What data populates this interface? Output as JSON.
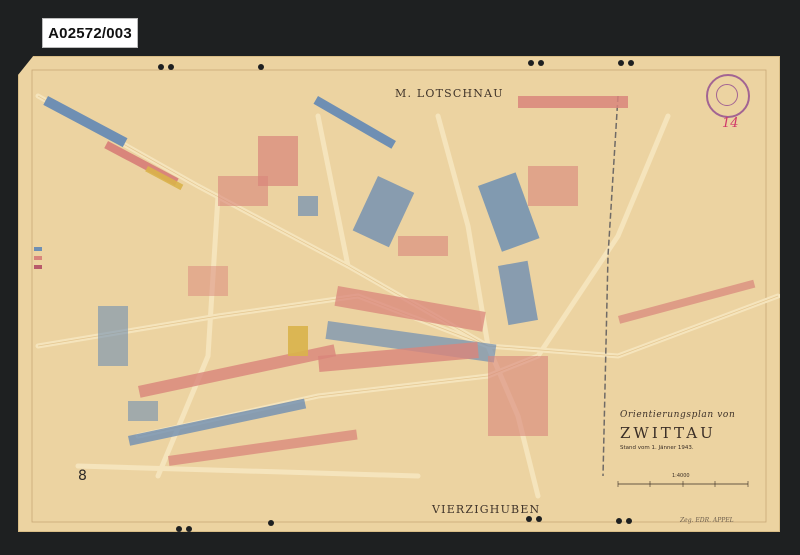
{
  "catalog_id": "A02572/003",
  "map": {
    "north_label": "M. LOTSCHNAU",
    "south_label": "VIERZIGHUBEN",
    "sheet_number": "8",
    "annotation": "14",
    "title_line1": "Orientierungsplan von",
    "title_line2": "ZWITTAU",
    "title_line3": "Stand vom 1. Jänner 1943.",
    "scale_label": "1:4000",
    "signature": "Zeg. EDR. APPEL",
    "colors": {
      "paper": "#ecd3a1",
      "road": "#f2dfb4",
      "rail": "#6f6a66",
      "building_blue": "#6f8fb3",
      "building_red": "#d9857b",
      "building_yellow": "#d9b24a",
      "stamp": "#8a3f8f",
      "annotation": "#d0386a"
    },
    "legend": [
      {
        "color": "#6f8fb3"
      },
      {
        "color": "#d9857b"
      },
      {
        "color": "#b85a6a"
      }
    ]
  }
}
